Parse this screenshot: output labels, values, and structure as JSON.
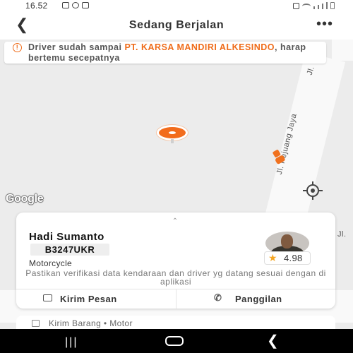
{
  "status_bar": {
    "time": "16.52"
  },
  "header": {
    "back_icon": "chevron-left-icon",
    "title": "Sedang Berjalan",
    "more_icon": "more-horizontal-icon"
  },
  "notice": {
    "icon": "info-icon",
    "text_before": "Driver sudah sampai ",
    "highlight": "PT. KARSA MANDIRI ALKESINDO",
    "text_after": ", harap bertemu secepatnya",
    "highlight_color": "#ef6c1a"
  },
  "map": {
    "road_labels": [
      "Jl.",
      "Jl. Pejuang Jaya",
      "Jl."
    ],
    "attribution": "Google"
  },
  "driver": {
    "name": "Hadi Sumanto",
    "plate": "B3247UKR",
    "vehicle_type": "Motorcycle",
    "rating": "4.98",
    "verify_note": "Pastikan verifikasi data kendaraan dan driver yg datang sesuai dengan di aplikasi"
  },
  "actions": {
    "chat": "Kirim Pesan",
    "call": "Panggilan"
  },
  "service": {
    "label": "Kirim Barang • Motor"
  },
  "colors": {
    "accent": "#f26c1c",
    "rating_star": "#f5a623"
  }
}
